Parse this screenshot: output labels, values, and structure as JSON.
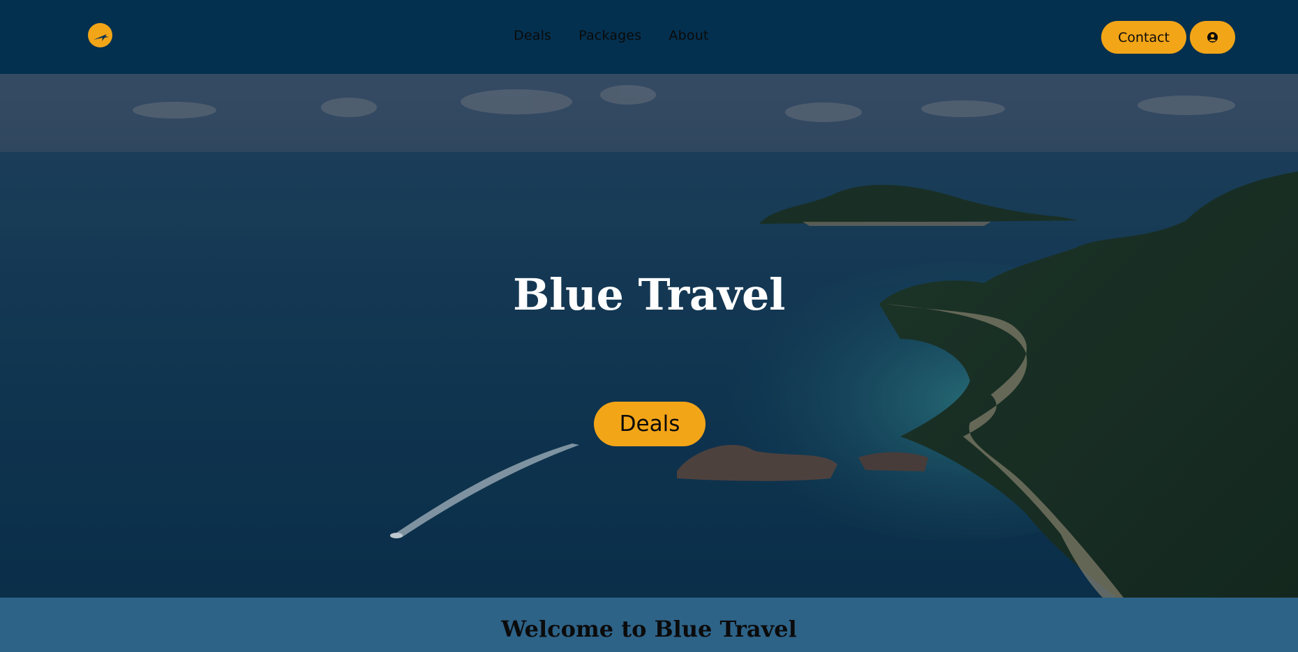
{
  "brand": {
    "logo_icon": "sun-plane-logo-icon",
    "accent_color": "#f3a518",
    "nav_bg": "#03304f"
  },
  "nav": {
    "links": [
      {
        "label": "Deals"
      },
      {
        "label": "Packages"
      },
      {
        "label": "About"
      }
    ],
    "contact_label": "Contact",
    "user_icon": "user-circle-icon"
  },
  "hero": {
    "title": "Blue Travel",
    "cta_label": "Deals",
    "background": "aerial-island-beach-photo"
  },
  "welcome": {
    "title": "Welcome to Blue Travel"
  }
}
